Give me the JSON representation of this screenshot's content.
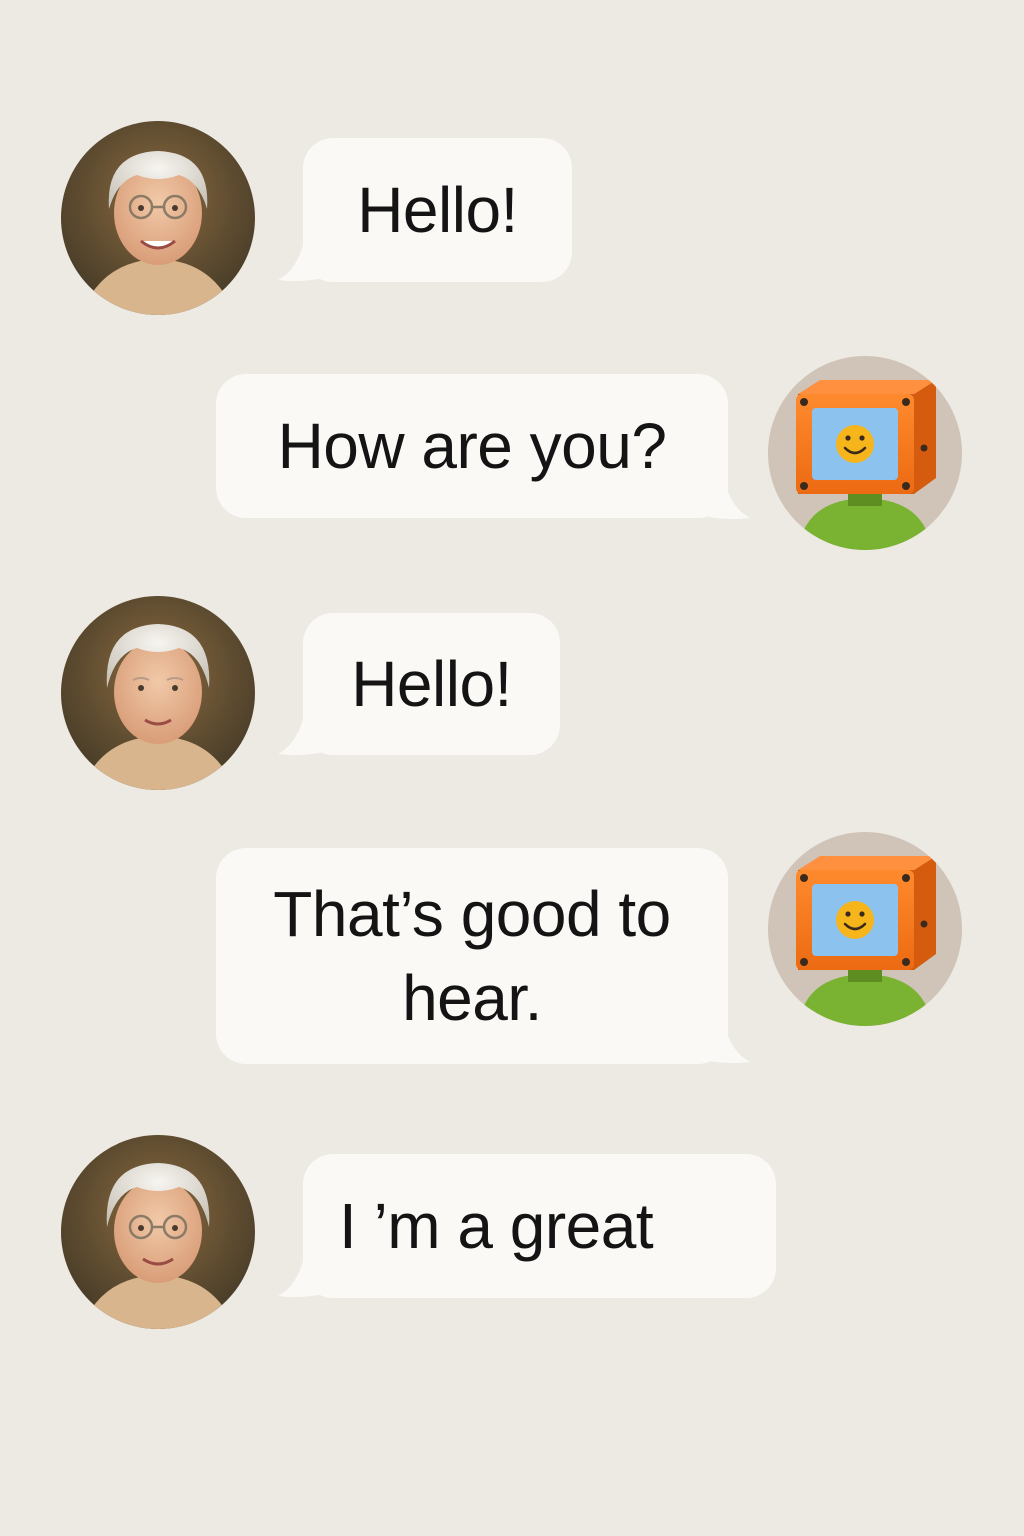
{
  "conversation": {
    "messages": [
      {
        "sender": "user",
        "text": "Hello!"
      },
      {
        "sender": "robot",
        "text": "How are you?"
      },
      {
        "sender": "user",
        "text": "Hello!"
      },
      {
        "sender": "robot",
        "text": "That’s good to hear."
      },
      {
        "sender": "user",
        "text": "I ’m a great"
      }
    ]
  },
  "colors": {
    "background": "#ede9e3",
    "bubble": "#faf9f6",
    "text": "#141414",
    "robot_head": "#f0731e",
    "robot_screen": "#8cc3ee",
    "robot_body": "#7ab232",
    "smiley": "#f7b51c"
  },
  "icons": {
    "user_avatar": "elderly-woman-avatar",
    "robot_avatar": "robot-avatar"
  }
}
